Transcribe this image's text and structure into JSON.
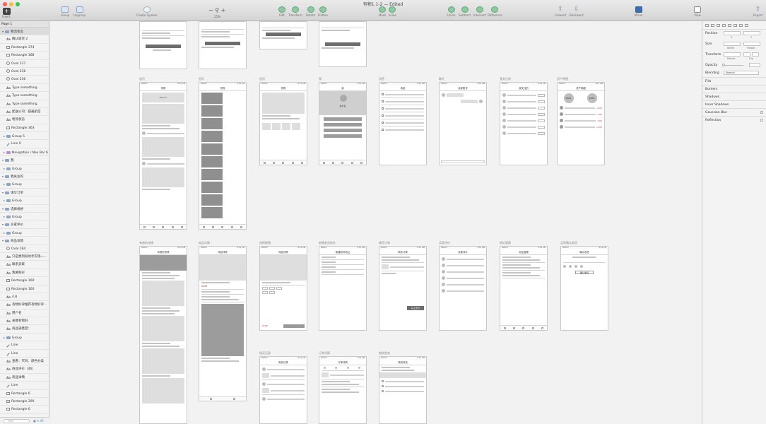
{
  "window": {
    "title": "有物1.1-2 — Edited"
  },
  "toolbar": {
    "insert": "Insert",
    "group": "Group",
    "ungroup": "Ungroup",
    "create_symbol": "Create Symbol",
    "zoom": "25%",
    "edit": "Edit",
    "transform": "Transform",
    "rotate": "Rotate",
    "flatten": "Flatten",
    "mask": "Mask",
    "scale": "Scale",
    "union": "Union",
    "subtract": "Subtract",
    "intersect": "Intersect",
    "difference": "Difference",
    "forward": "Forward",
    "backward": "Backward",
    "mirror": "Mirror",
    "view": "View",
    "export": "Export"
  },
  "layers": {
    "page": "Page 1",
    "items": [
      {
        "label": "物流状态",
        "kind": "folder",
        "level": 0,
        "arrow": "▾"
      },
      {
        "label": "确认收货 2",
        "kind": "text",
        "level": 1
      },
      {
        "label": "Rectangle 374",
        "kind": "rect",
        "level": 1
      },
      {
        "label": "Rectangle 368",
        "kind": "rect",
        "level": 1
      },
      {
        "label": "Oval 237",
        "kind": "oval",
        "level": 1
      },
      {
        "label": "Oval 236",
        "kind": "oval",
        "level": 1
      },
      {
        "label": "Oval 236",
        "kind": "oval",
        "level": 1
      },
      {
        "label": "Type something",
        "kind": "text",
        "level": 1
      },
      {
        "label": "Type something",
        "kind": "text",
        "level": 1
      },
      {
        "label": "Type something",
        "kind": "text",
        "level": 1
      },
      {
        "label": "配送公司：圆通航空",
        "kind": "text",
        "level": 1
      },
      {
        "label": "物流状态",
        "kind": "text",
        "level": 1
      },
      {
        "label": "Rectangle 363",
        "kind": "rect",
        "level": 1
      },
      {
        "label": "Group 5",
        "kind": "group",
        "level": 1,
        "arrow": "▸"
      },
      {
        "label": "Line 9",
        "kind": "line",
        "level": 1
      },
      {
        "label": "Navigation / Nav Bar 6",
        "kind": "symbol",
        "level": 1,
        "arrow": "▸"
      },
      {
        "label": "我",
        "kind": "folder",
        "level": 0,
        "arrow": "▾"
      },
      {
        "label": "Group",
        "kind": "group",
        "level": 1,
        "arrow": "▸"
      },
      {
        "label": "我关注的",
        "kind": "folder",
        "level": 0,
        "arrow": "▾"
      },
      {
        "label": "Group",
        "kind": "group",
        "level": 1,
        "arrow": "▸"
      },
      {
        "label": "填写订单",
        "kind": "folder",
        "level": 0,
        "arrow": "▾"
      },
      {
        "label": "Group",
        "kind": "group",
        "level": 1,
        "arrow": "▸"
      },
      {
        "label": "选择规格",
        "kind": "folder",
        "level": 0,
        "arrow": "▾"
      },
      {
        "label": "Group",
        "kind": "group",
        "level": 1,
        "arrow": "▸"
      },
      {
        "label": "买家评价",
        "kind": "folder",
        "level": 0,
        "arrow": "▾"
      },
      {
        "label": "Group",
        "kind": "group",
        "level": 1,
        "arrow": "▸"
      },
      {
        "label": "商品详情",
        "kind": "folder",
        "level": 0,
        "arrow": "▾"
      },
      {
        "label": "Oval 184",
        "kind": "oval",
        "level": 1
      },
      {
        "label": "只是想到就动手实现一...",
        "kind": "text",
        "level": 1
      },
      {
        "label": "联系卖家",
        "kind": "text",
        "level": 1
      },
      {
        "label": "我要购买",
        "kind": "text",
        "level": 1
      },
      {
        "label": "Rectangle 160",
        "kind": "rect",
        "level": 1
      },
      {
        "label": "Rectangle 160",
        "kind": "rect",
        "level": 1
      },
      {
        "label": "4.8",
        "kind": "text",
        "level": 1
      },
      {
        "label": "有物好评推荐有物好评...",
        "kind": "text",
        "level": 1
      },
      {
        "label": "用户名",
        "kind": "text",
        "level": 1
      },
      {
        "label": "关键有物好",
        "kind": "text",
        "level": 1
      },
      {
        "label": "商品满意度：",
        "kind": "text",
        "level": 1
      },
      {
        "label": "Group",
        "kind": "group",
        "level": 1,
        "arrow": "▸"
      },
      {
        "label": "Line",
        "kind": "line",
        "level": 1
      },
      {
        "label": "Line",
        "kind": "line",
        "level": 1
      },
      {
        "label": "查看：尺码、颜色分类",
        "kind": "text",
        "level": 1
      },
      {
        "label": "商品评价（46）",
        "kind": "text",
        "level": 1
      },
      {
        "label": "商品详情",
        "kind": "text",
        "level": 1
      },
      {
        "label": "Line",
        "kind": "line",
        "level": 1
      },
      {
        "label": "Rectangle 6",
        "kind": "rect",
        "level": 1
      },
      {
        "label": "Rectangle 299",
        "kind": "rect",
        "level": 1
      },
      {
        "label": "Rectangle 6",
        "kind": "rect",
        "level": 1
      }
    ],
    "search_placeholder": "Filter"
  },
  "artboards": {
    "row1": [
      {
        "label": "首页",
        "title": "有物"
      },
      {
        "label": "首页",
        "title": "有物"
      },
      {
        "label": "首页",
        "title": "有物"
      },
      {
        "label": "我",
        "title": "我"
      },
      {
        "label": "消息",
        "title": "消息"
      },
      {
        "label": "聊天",
        "title": "卖家账号"
      },
      {
        "label": "我关注的",
        "title": "我关注的"
      },
      {
        "label": "资产明细",
        "title": "资产明细"
      }
    ],
    "row2": [
      {
        "label": "有物的详情",
        "title": "有物的详情"
      },
      {
        "label": "商品详情",
        "title": "商品详情"
      },
      {
        "label": "选择规格",
        "title": "商品详情"
      },
      {
        "label": "新建收货地址",
        "title": "新建收货地址"
      },
      {
        "label": "填写订单",
        "title": "填写订单"
      },
      {
        "label": "买家评价",
        "title": "买家评价"
      },
      {
        "label": "地址管理",
        "title": "地址管理"
      },
      {
        "label": "买家确认收货",
        "title": "确认收货"
      }
    ],
    "row3": [
      {
        "label": "购买记录",
        "title": "购买记录"
      },
      {
        "label": "订单详情",
        "title": "订单详情"
      },
      {
        "label": "物流状态",
        "title": "物流状态"
      }
    ],
    "status_carrier": "Sketch",
    "status_time": "9:41 AM",
    "banner": "Banner",
    "username": "用户名",
    "buy_button": "马上支付",
    "price_a": "¥228",
    "price_b": "¥500",
    "confirm_button": "确认收货"
  },
  "inspector": {
    "position": "Position",
    "x": "X",
    "y": "Y",
    "size": "Size",
    "width": "Width",
    "height": "Height",
    "transform": "Transform",
    "rotate": "Rotate",
    "flip": "Flip",
    "opacity": "Opacity",
    "blending": "Blending",
    "blending_value": "Normal",
    "fills": "Fills",
    "borders": "Borders",
    "shadows": "Shadows",
    "inner_shadows": "Inner Shadows",
    "gaussian_blur": "Gaussian Blur",
    "reflection": "Reflection"
  }
}
